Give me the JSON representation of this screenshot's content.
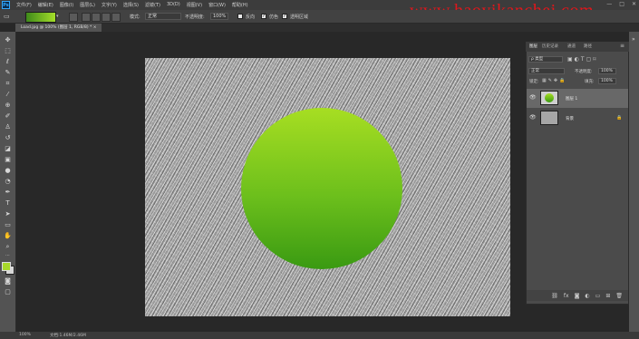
{
  "menubar": {
    "logo": "Ps",
    "items": [
      "文件(F)",
      "编辑(E)",
      "图像(I)",
      "图层(L)",
      "文字(Y)",
      "选择(S)",
      "滤镜(T)",
      "3D(D)",
      "视图(V)",
      "窗口(W)",
      "帮助(H)"
    ],
    "window_controls": [
      "—",
      "□",
      "✕"
    ]
  },
  "watermark": "www.haoyikanchei.com",
  "options_bar": {
    "mode_label": "模式:",
    "mode_value": "正常",
    "opacity_label": "不透明度:",
    "opacity_value": "100%",
    "reverse_label": "反向",
    "dither_label": "仿色",
    "transparency_label": "透明区域",
    "dither_checked": true,
    "transparency_checked": true
  },
  "document_tab": "Load.jpg @ 100% (图层 1, RGB/8) * ×",
  "layers_panel": {
    "tabs": [
      "图层",
      "历史记录",
      "通道",
      "路径"
    ],
    "kind_label": "ρ 类型",
    "blend_mode": "正常",
    "opacity_label": "不透明度:",
    "opacity_value": "100%",
    "lock_label": "锁定:",
    "fill_label": "填充:",
    "fill_value": "100%",
    "layers": [
      {
        "name": "图层 1",
        "selected": true,
        "visible": true
      },
      {
        "name": "背景",
        "selected": false,
        "visible": true,
        "locked": true
      }
    ],
    "footer_icons": [
      "link-icon",
      "fx-icon",
      "mask-icon",
      "adjustment-icon",
      "group-icon",
      "new-layer-icon",
      "trash-icon"
    ]
  },
  "statusbar": {
    "zoom": "100%",
    "doc_info": "文档:1.46M/2.46M"
  },
  "colors": {
    "accent_green_top": "#a7de22",
    "accent_green_bottom": "#3a9a12",
    "foreground": "#a8d82a",
    "background": "#d8d8d8"
  }
}
